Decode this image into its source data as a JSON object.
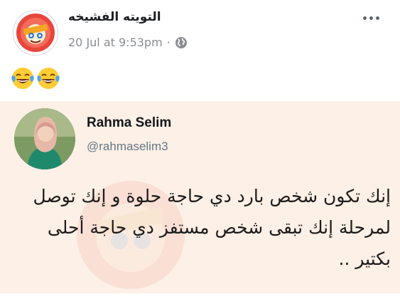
{
  "post": {
    "page_name": "التويته الفشيخه",
    "timestamp": "20 Jul at 9:53pm",
    "separator": "·",
    "privacy_icon": "globe-icon",
    "more_icon": "more-options-icon",
    "emoji": [
      "face-with-tears-of-joy",
      "face-with-tears-of-joy"
    ]
  },
  "tweet": {
    "name": "Rahma Selim",
    "handle": "@rahmaselim3",
    "text": "إنك تكون شخص بارد دي حاجة حلوة و إنك توصل لمرحلة إنك تبقى شخص مستفز دي حاجة أحلى بكتير .."
  },
  "colors": {
    "tweet_background": "#fdf0e6",
    "meta_text": "#8a8d91",
    "handle_text": "#657786"
  }
}
